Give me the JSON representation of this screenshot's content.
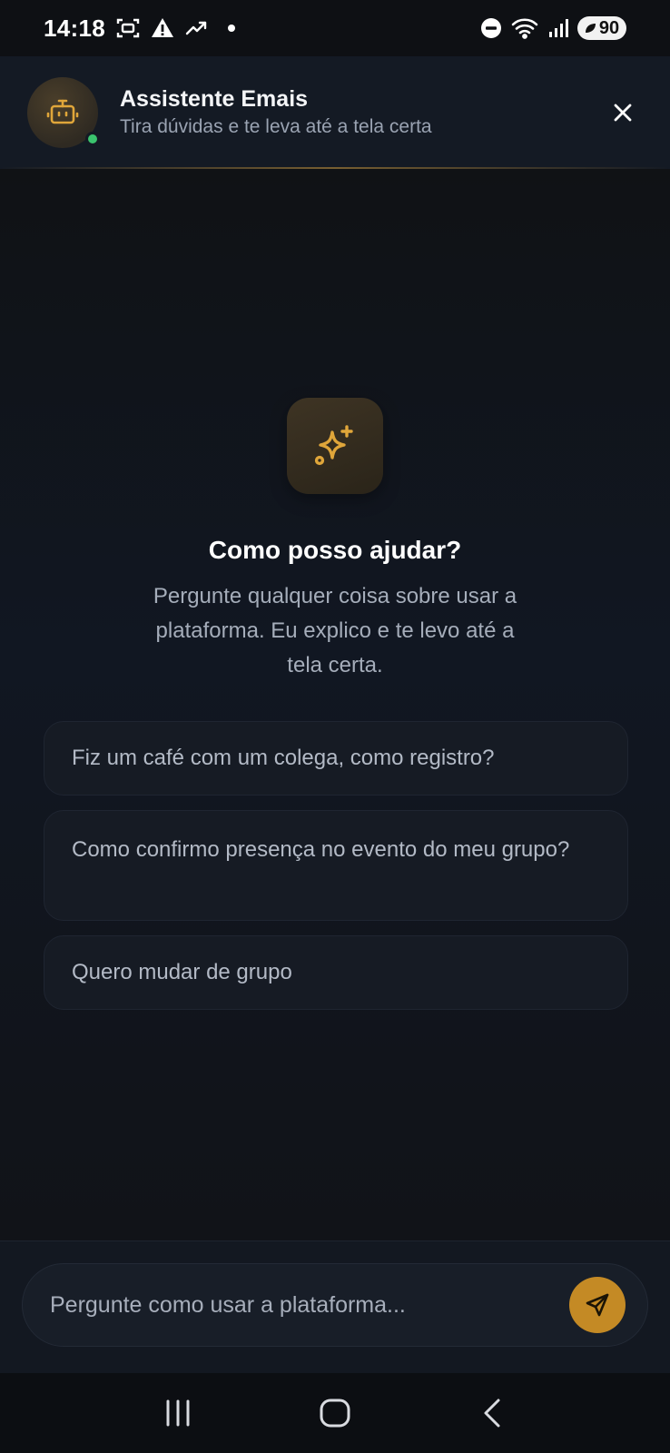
{
  "status_bar": {
    "time": "14:18",
    "battery": "90"
  },
  "header": {
    "title": "Assistente Emais",
    "subtitle": "Tira dúvidas e te leva até a tela certa",
    "online_color": "#3bc46e"
  },
  "hero": {
    "title": "Como posso ajudar?",
    "subtitle": "Pergunte qualquer coisa sobre usar a plataforma. Eu explico e te levo até a tela certa."
  },
  "suggestions": [
    {
      "label": "Fiz um café com um colega, como registro?"
    },
    {
      "label": "Como confirmo presença no evento do meu grupo?"
    },
    {
      "label": "Quero mudar de grupo"
    }
  ],
  "input": {
    "placeholder": "Pergunte como usar a plataforma...",
    "value": ""
  },
  "colors": {
    "accent": "#c48a25",
    "icon_gold": "#e0a63a"
  }
}
